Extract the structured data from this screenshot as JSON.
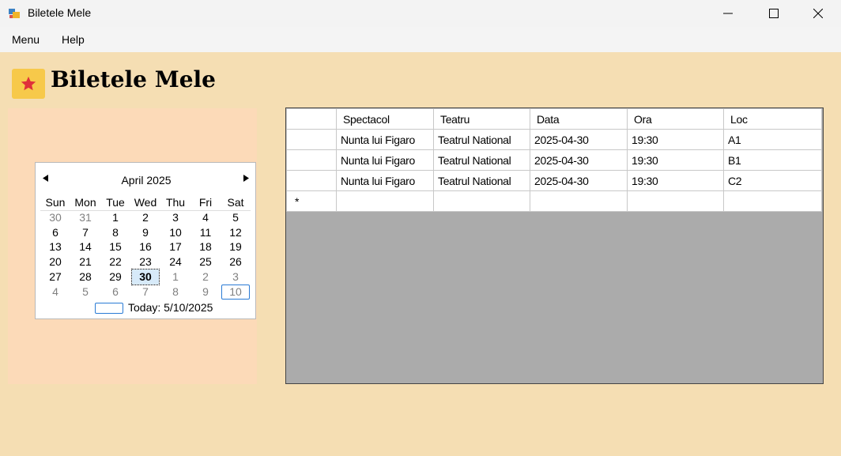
{
  "window": {
    "title": "Biletele Mele",
    "minimize": "—",
    "maximize": "☐",
    "close": "✕"
  },
  "menu": {
    "items": [
      "Menu",
      "Help"
    ]
  },
  "app": {
    "title": "Biletele Mele",
    "logo_icon": "star-ticket-icon"
  },
  "calendar": {
    "month_label": "April 2025",
    "prev": "◀",
    "next": "▶",
    "days_of_week": [
      "Sun",
      "Mon",
      "Tue",
      "Wed",
      "Thu",
      "Fri",
      "Sat"
    ],
    "weeks": [
      [
        "30",
        "31",
        "1",
        "2",
        "3",
        "4",
        "5"
      ],
      [
        "6",
        "7",
        "8",
        "9",
        "10",
        "11",
        "12"
      ],
      [
        "13",
        "14",
        "15",
        "16",
        "17",
        "18",
        "19"
      ],
      [
        "20",
        "21",
        "22",
        "23",
        "24",
        "25",
        "26"
      ],
      [
        "27",
        "28",
        "29",
        "30",
        "1",
        "2",
        "3"
      ],
      [
        "4",
        "5",
        "6",
        "7",
        "8",
        "9",
        "10"
      ]
    ],
    "selected_day": "30",
    "today_label": "Today: 5/10/2025"
  },
  "grid": {
    "columns": [
      "Spectacol",
      "Teatru",
      "Data",
      "Ora",
      "Loc"
    ],
    "rows": [
      [
        "Nunta lui Figaro",
        "Teatrul National",
        "2025-04-30",
        "19:30",
        "A1"
      ],
      [
        "Nunta lui Figaro",
        "Teatrul National",
        "2025-04-30",
        "19:30",
        "B1"
      ],
      [
        "Nunta lui Figaro",
        "Teatrul National",
        "2025-04-30",
        "19:30",
        "C2"
      ]
    ],
    "new_row_marker": "*"
  }
}
